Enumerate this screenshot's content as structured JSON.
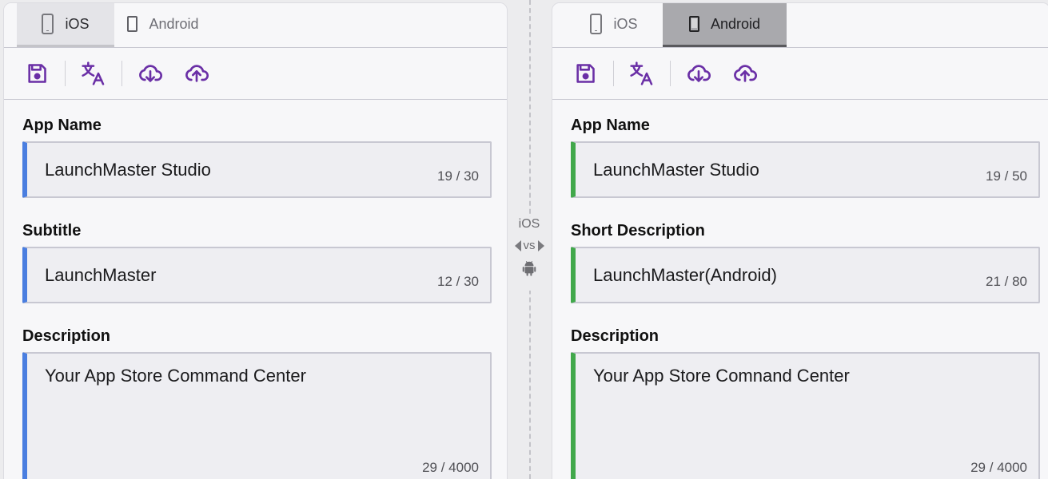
{
  "left_panel": {
    "tabs": [
      {
        "label": "iOS",
        "icon": "phone-outline-icon",
        "active": true
      },
      {
        "label": "Android",
        "icon": "phone-solid-icon",
        "active": false
      }
    ],
    "toolbar": [
      "save-icon",
      "translate-icon",
      "cloud-download-icon",
      "cloud-upload-icon"
    ],
    "fields": [
      {
        "label": "App Name",
        "value": "LaunchMaster Studio",
        "count": "19 / 30"
      },
      {
        "label": "Subtitle",
        "value": "LaunchMaster",
        "count": "12 / 30"
      },
      {
        "label": "Description",
        "value": "Your App Store Command Center",
        "count": "29 / 4000"
      }
    ],
    "accent_color": "#4a7ee0"
  },
  "right_panel": {
    "tabs": [
      {
        "label": "iOS",
        "icon": "phone-outline-icon",
        "active": false
      },
      {
        "label": "Android",
        "icon": "phone-solid-icon",
        "active": true
      }
    ],
    "toolbar": [
      "save-icon",
      "translate-icon",
      "cloud-download-icon",
      "cloud-upload-icon"
    ],
    "fields": [
      {
        "label": "App Name",
        "value": "LaunchMaster Studio",
        "count": "19 / 50"
      },
      {
        "label": "Short Description",
        "value": "LaunchMaster(Android)",
        "count": "21 / 80"
      },
      {
        "label": "Description",
        "value": "Your App Store Comnand Center",
        "count": "29 / 4000"
      }
    ],
    "accent_color": "#41a84b"
  },
  "compare": {
    "top_label": "iOS",
    "middle_label": "vs",
    "bottom_icon": "android-icon"
  },
  "icon_color": "#6a2fa6"
}
